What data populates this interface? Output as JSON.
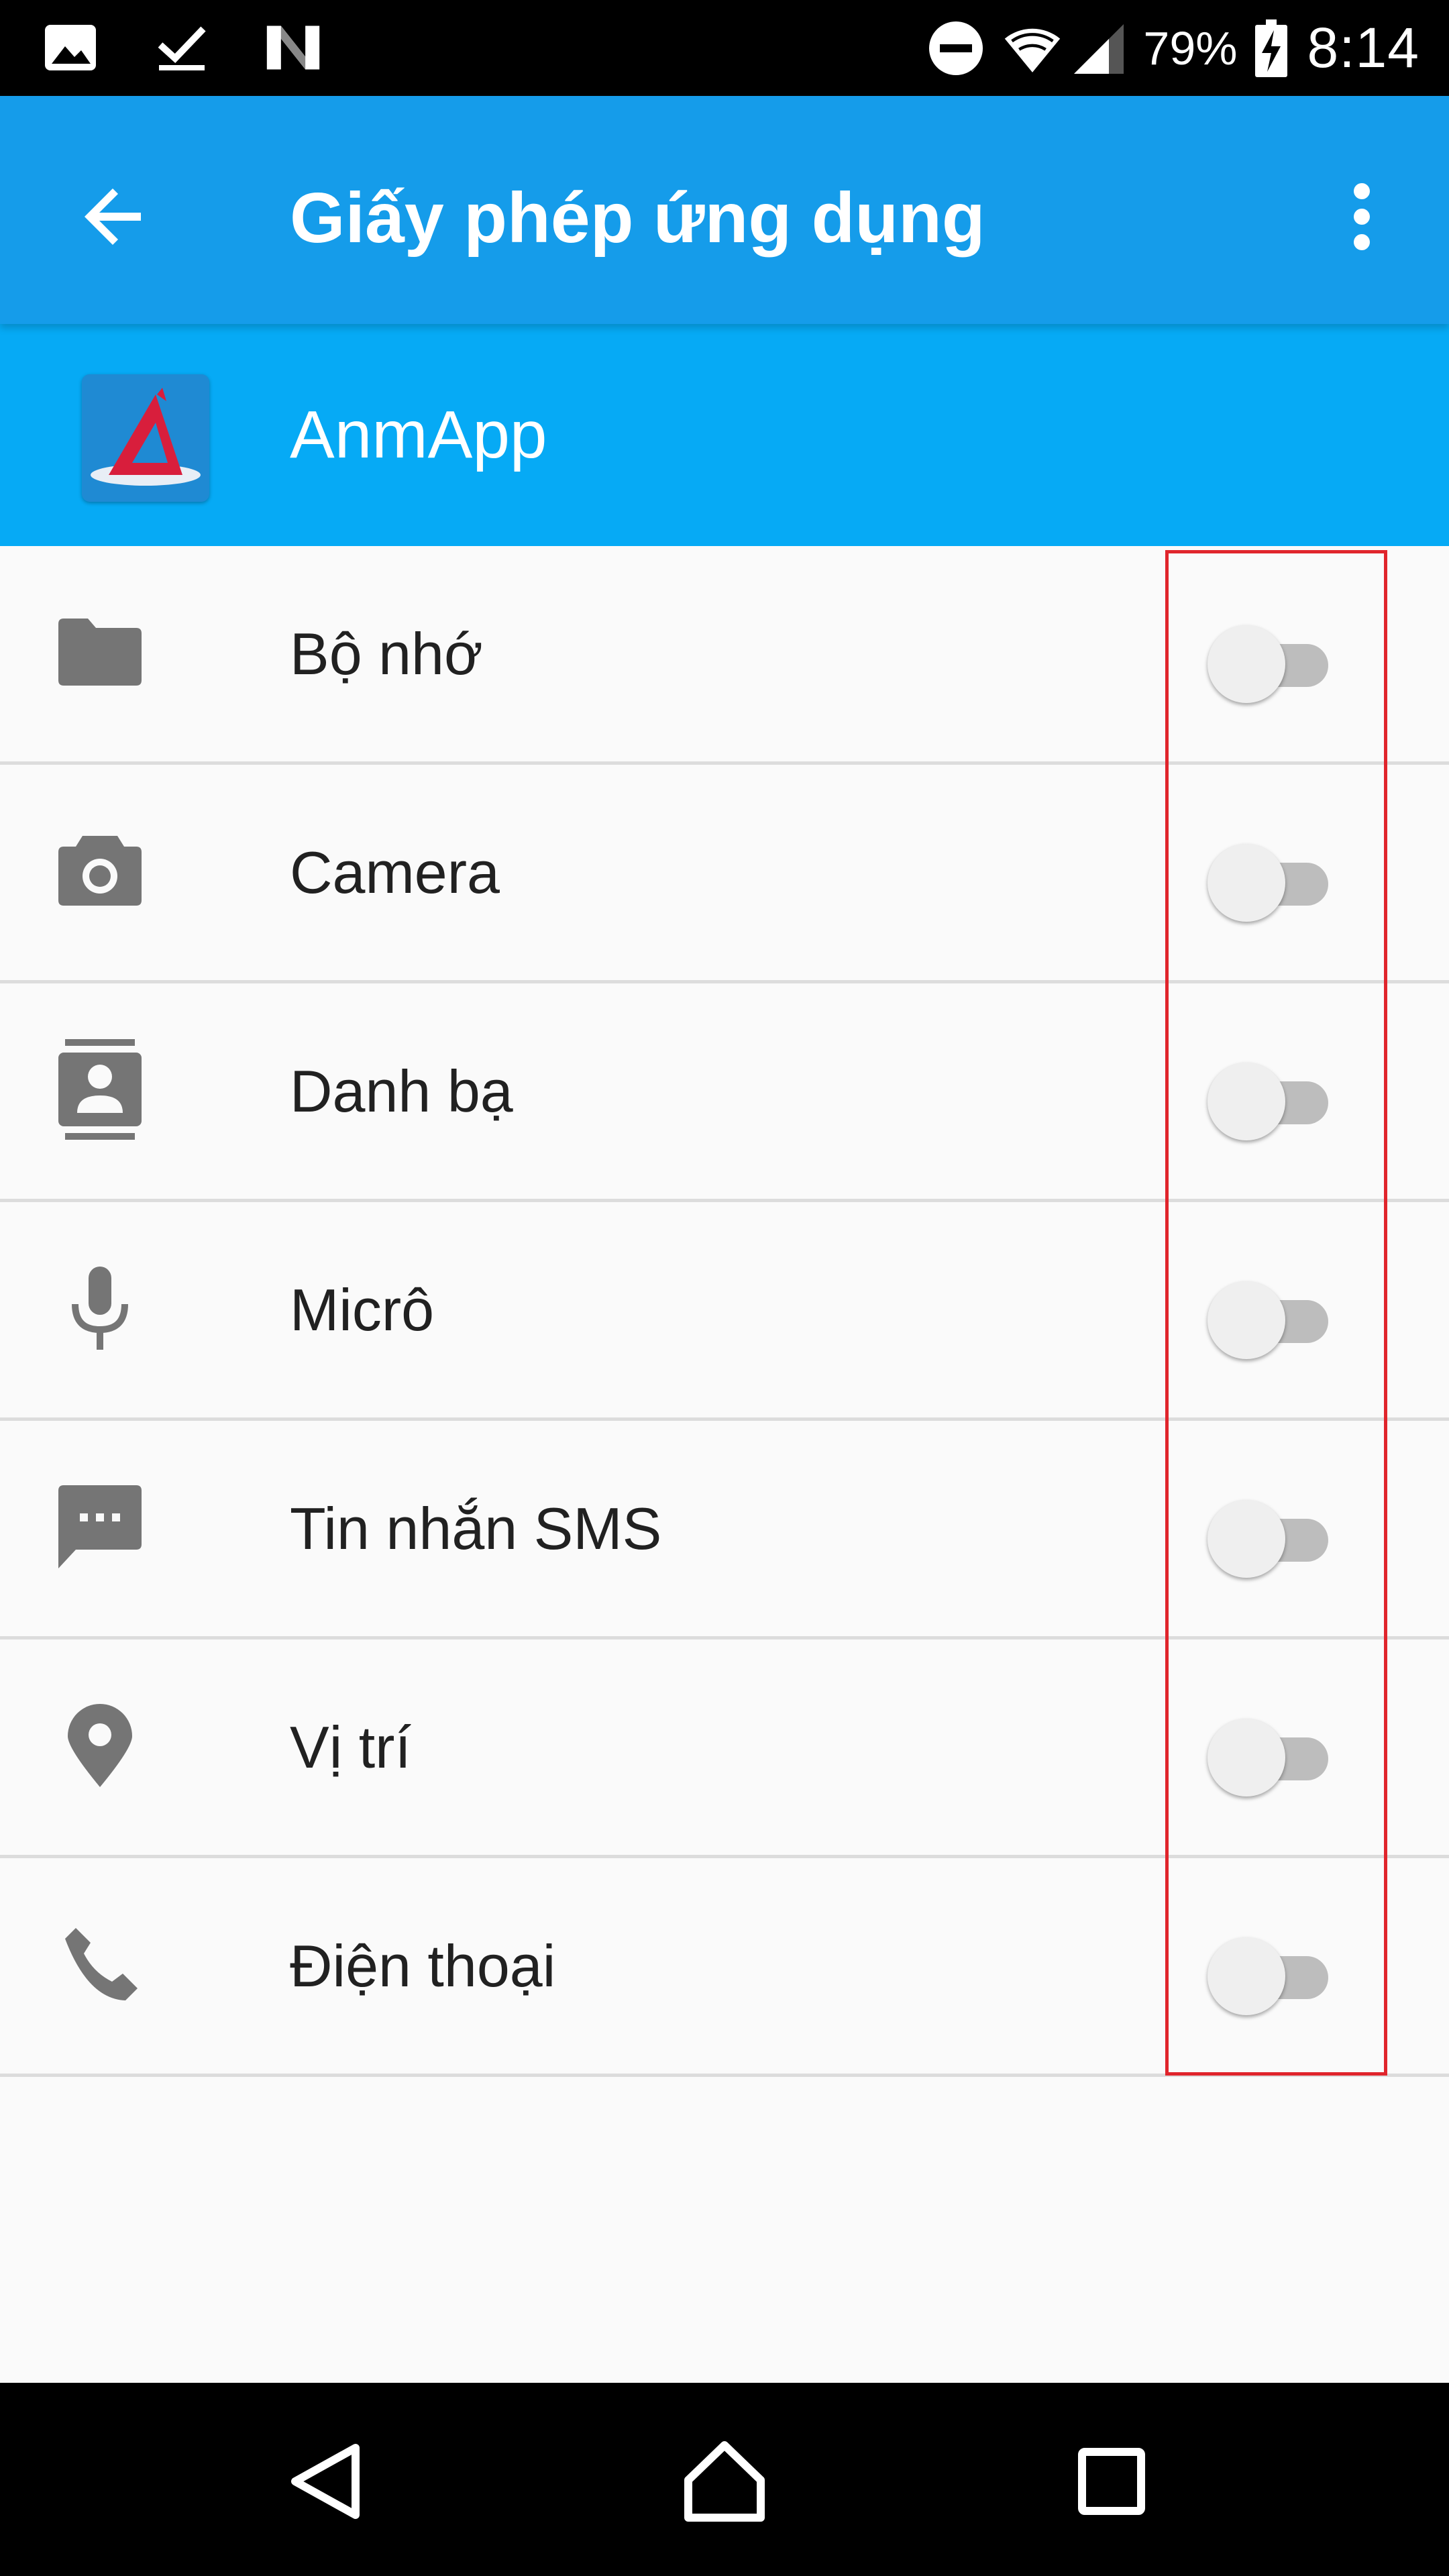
{
  "status_bar": {
    "battery_percent": "79%",
    "time": "8:14",
    "left_icons": [
      "image-icon",
      "download-done-icon",
      "n-logo-icon"
    ],
    "right_icons": [
      "do-not-disturb-icon",
      "wifi-icon",
      "signal-icon",
      "battery-charging-icon"
    ]
  },
  "app_bar": {
    "title": "Giấy phép ứng dụng",
    "back_icon": "arrow-back-icon",
    "menu_icon": "more-vert-icon",
    "color": "#159cea"
  },
  "app_header": {
    "name": "AnmApp",
    "color": "#06aaf5"
  },
  "permissions": [
    {
      "label": "Bộ nhớ",
      "icon": "folder-icon",
      "enabled": false
    },
    {
      "label": "Camera",
      "icon": "camera-icon",
      "enabled": false
    },
    {
      "label": "Danh bạ",
      "icon": "contacts-icon",
      "enabled": false
    },
    {
      "label": "Micrô",
      "icon": "mic-icon",
      "enabled": false
    },
    {
      "label": "Tin nhắn SMS",
      "icon": "sms-icon",
      "enabled": false
    },
    {
      "label": "Vị trí",
      "icon": "location-icon",
      "enabled": false
    },
    {
      "label": "Điện thoại",
      "icon": "phone-icon",
      "enabled": false
    }
  ],
  "nav_bar": {
    "icons": [
      "back-triangle-icon",
      "home-icon",
      "recents-icon"
    ]
  },
  "highlight_color": "#e0252c"
}
